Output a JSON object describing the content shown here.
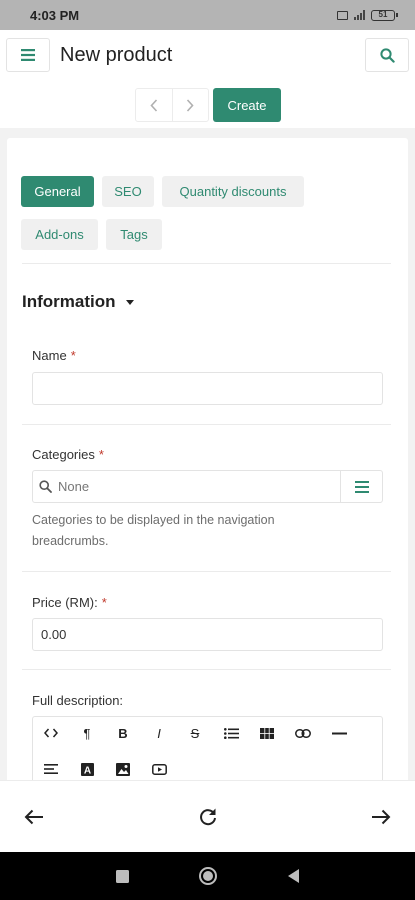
{
  "status_bar": {
    "time": "4:03 PM",
    "battery": "51"
  },
  "header": {
    "title": "New product"
  },
  "toolbar": {
    "create_label": "Create"
  },
  "tabs": [
    "General",
    "SEO",
    "Quantity discounts",
    "Add-ons",
    "Tags"
  ],
  "active_tab": "General",
  "section": {
    "title": "Information"
  },
  "fields": {
    "name": {
      "label": "Name",
      "required_mark": "*",
      "value": ""
    },
    "categories": {
      "label": "Categories",
      "required_mark": "*",
      "placeholder": "None",
      "help": "Categories to be displayed in the navigation breadcrumbs."
    },
    "price": {
      "label": "Price (RM):",
      "required_mark": "*",
      "value": "0.00"
    },
    "full_description": {
      "label": "Full description:"
    }
  },
  "editor_toolbar": [
    {
      "name": "code-view-icon",
      "glyph": "<>"
    },
    {
      "name": "paragraph-icon",
      "glyph": "¶"
    },
    {
      "name": "bold-icon",
      "glyph": "B"
    },
    {
      "name": "italic-icon",
      "glyph": "I"
    },
    {
      "name": "strikethrough-icon",
      "glyph": "S"
    },
    {
      "name": "bulleted-list-icon",
      "glyph": ""
    },
    {
      "name": "table-icon",
      "glyph": ""
    },
    {
      "name": "link-icon",
      "glyph": ""
    },
    {
      "name": "horizontal-rule-icon",
      "glyph": "—"
    },
    {
      "name": "align-icon",
      "glyph": ""
    },
    {
      "name": "font-color-icon",
      "glyph": "A"
    },
    {
      "name": "image-icon",
      "glyph": ""
    },
    {
      "name": "video-icon",
      "glyph": ""
    }
  ],
  "colors": {
    "accent": "#2f8a71",
    "required": "#c0392b",
    "surface_bg": "#f2f2f2"
  }
}
